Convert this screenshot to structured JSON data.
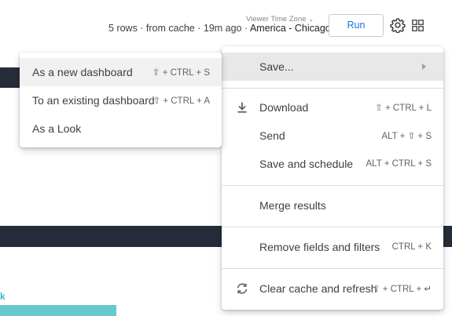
{
  "header": {
    "timezone_caption": "Viewer Time Zone",
    "status_text": "5 rows · from cache · 19m ago · ",
    "timezone_value": "America - Chicago",
    "run_label": "Run"
  },
  "page": {
    "link_fragment": "k"
  },
  "menu": {
    "save": {
      "label": "Save..."
    },
    "download": {
      "label": "Download",
      "shortcut": "⇧ + CTRL + L"
    },
    "send": {
      "label": "Send",
      "shortcut": "ALT + ⇧ + S"
    },
    "save_schedule": {
      "label": "Save and schedule",
      "shortcut": "ALT + CTRL + S"
    },
    "merge": {
      "label": "Merge results"
    },
    "remove_fields": {
      "label": "Remove fields and filters",
      "shortcut": "CTRL + K"
    },
    "clear_cache": {
      "label": "Clear cache and refresh",
      "shortcut": "⇧ + CTRL + ↵"
    }
  },
  "submenu": {
    "new_dashboard": {
      "label": "As a new dashboard",
      "shortcut": "⇧ + CTRL + S"
    },
    "existing_dashboard": {
      "label": "To an existing dashboard",
      "shortcut": "⇧ + CTRL + A"
    },
    "as_look": {
      "label": "As a Look"
    }
  },
  "icons": {
    "download": "download-icon",
    "refresh": "refresh-icon",
    "gear": "gear-icon",
    "grid": "grid-icon",
    "chevron": "chevron-down-icon"
  },
  "colors": {
    "accent": "#1a73e8",
    "dark_bar": "#262d3a",
    "teal": "#69c7d0",
    "highlight": "#e8e8e8"
  }
}
